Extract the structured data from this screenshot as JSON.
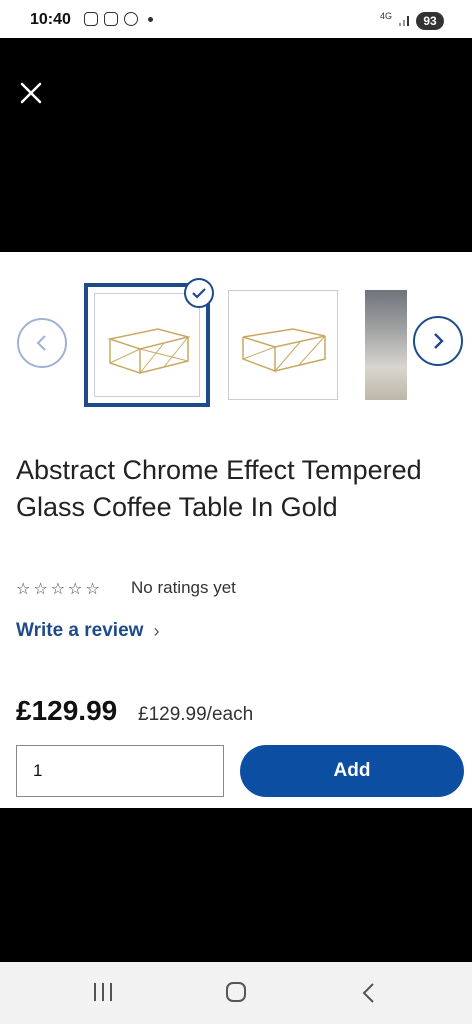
{
  "status_bar": {
    "time": "10:40",
    "network": "4G",
    "battery": "93"
  },
  "gallery": {
    "prev_label": "‹",
    "next_label": "›",
    "selected_index": 0,
    "thumbnail_count": 3
  },
  "product": {
    "title": "Abstract Chrome Effect Tempered Glass Coffee Table In Gold",
    "rating": {
      "stars": 0,
      "max_stars": 5,
      "text": "No ratings yet"
    },
    "review_link": "Write a review",
    "review_chevron": "›",
    "price": "£129.99",
    "unit_price": "£129.99/each"
  },
  "purchase": {
    "quantity": "1",
    "add_label": "Add"
  },
  "colors": {
    "brand_blue": "#0b4ea2",
    "accent_blue": "#1e4b8a"
  }
}
